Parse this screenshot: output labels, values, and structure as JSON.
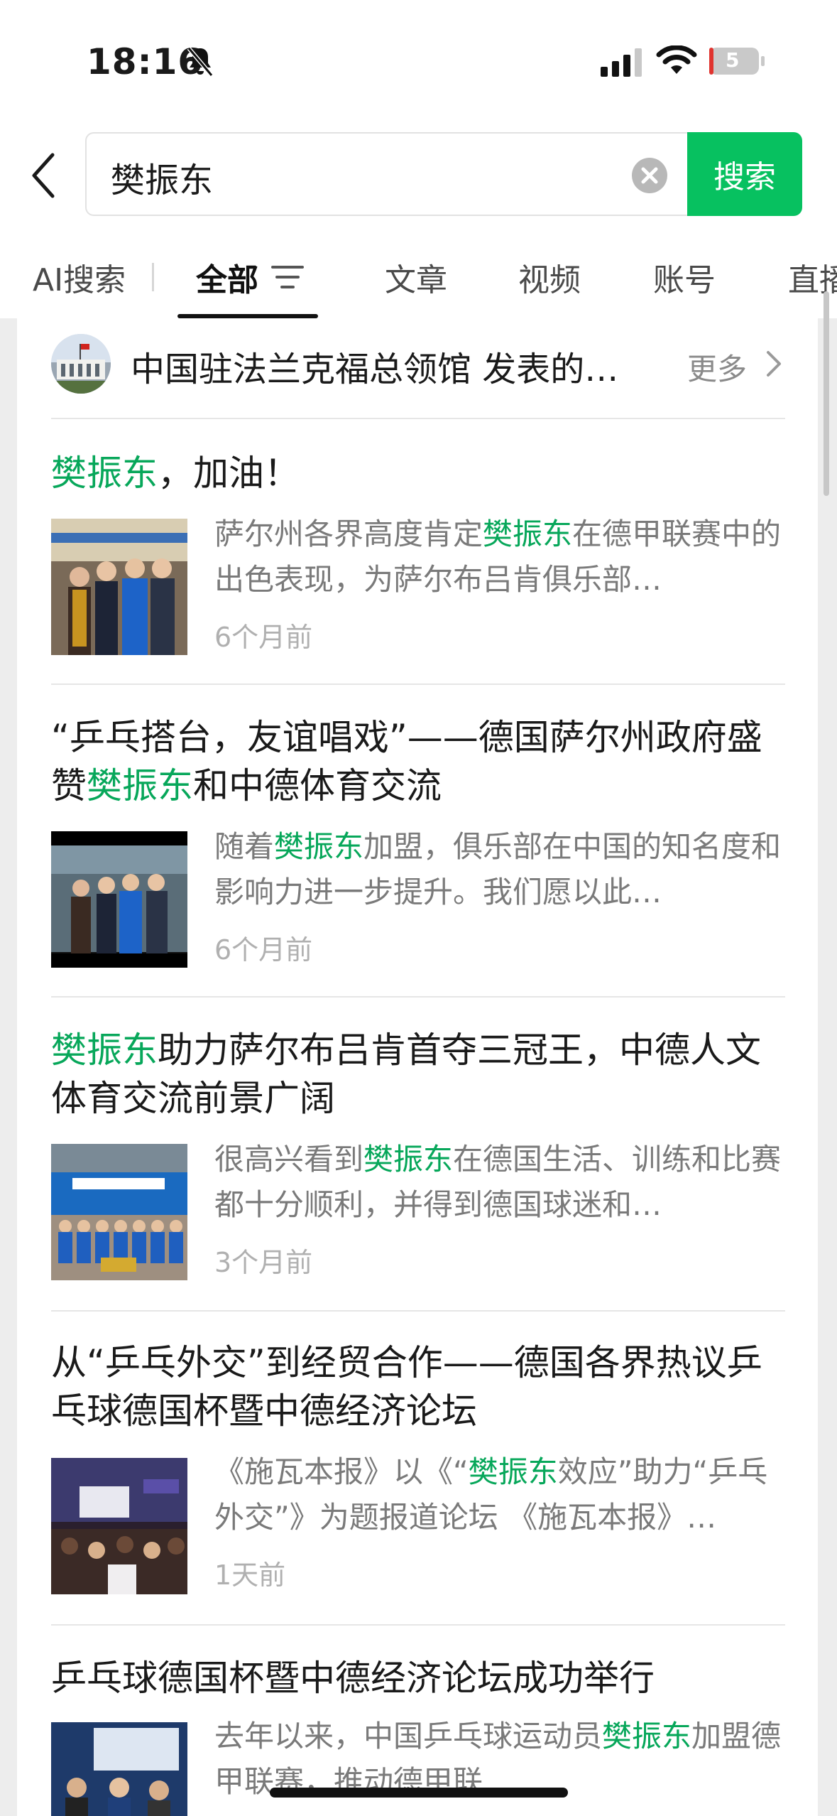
{
  "status_bar": {
    "time": "18:16",
    "battery_level": "5"
  },
  "search": {
    "query": "樊振东",
    "button_label": "搜索"
  },
  "tabs": [
    {
      "label": "AI搜索"
    },
    {
      "label": "全部"
    },
    {
      "label": "文章"
    },
    {
      "label": "视频"
    },
    {
      "label": "账号"
    },
    {
      "label": "直播"
    }
  ],
  "source": {
    "title": "中国驻法兰克福总领馆 发表的…",
    "more_label": "更多"
  },
  "articles": [
    {
      "title_pre": "",
      "title_hl": "樊振东",
      "title_post": "，加油！",
      "desc_pre": "萨尔州各界高度肯定",
      "desc_hl": "樊振东",
      "desc_post": "在德甲联赛中的出色表现，为萨尔布吕肯俱乐部…",
      "time": "6个月前"
    },
    {
      "title_pre": "“乒乓搭台，友谊唱戏”——德国萨尔州政府盛赞",
      "title_hl": "樊振东",
      "title_post": "和中德体育交流",
      "desc_pre": "随着",
      "desc_hl": "樊振东",
      "desc_post": "加盟，俱乐部在中国的知名度和影响力进一步提升。我们愿以此…",
      "time": "6个月前"
    },
    {
      "title_pre": "",
      "title_hl": "樊振东",
      "title_post": "助力萨尔布吕肯首夺三冠王，中德人文体育交流前景广阔",
      "desc_pre": "很高兴看到",
      "desc_hl": "樊振东",
      "desc_post": "在德国生活、训练和比赛都十分顺利，并得到德国球迷和…",
      "time": "3个月前"
    },
    {
      "title_pre": "从“乒乓外交”到经贸合作——德国各界热议乒乓球德国杯暨中德经济论坛",
      "title_hl": "",
      "title_post": "",
      "desc_pre": "《施瓦本报》以《“",
      "desc_hl": "樊振东",
      "desc_post": "效应”助力“乒乓外交”》为题报道论坛 《施瓦本报》…",
      "time": "1天前"
    },
    {
      "title_pre": "乒乓球德国杯暨中德经济论坛成功举行",
      "title_hl": "",
      "title_post": "",
      "desc_pre": "去年以来，中国乒乓球运动员",
      "desc_hl": "樊振东",
      "desc_post": "加盟德甲联赛，推动德甲联…",
      "time": ""
    }
  ],
  "colors": {
    "accent": "#07c160",
    "highlight": "#07a75a",
    "background": "#ededed"
  }
}
